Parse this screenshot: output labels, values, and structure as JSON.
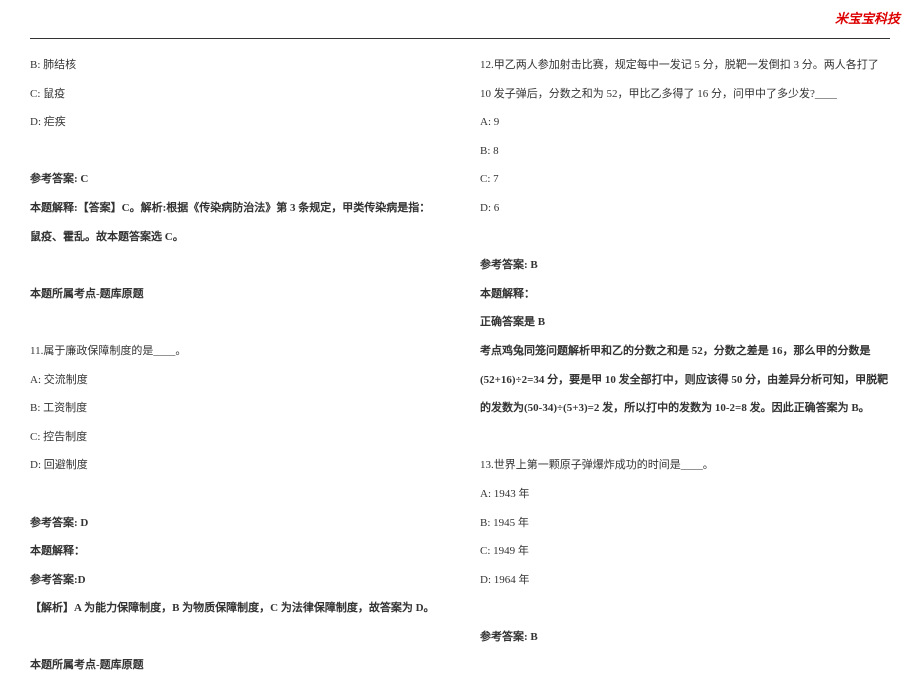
{
  "watermark": "米宝宝科技",
  "left": {
    "q10_opt_b": "B: 肺结核",
    "q10_opt_c": "C: 鼠疫",
    "q10_opt_d": "D: 疟疾",
    "q10_ans_label": "参考答案: C",
    "q10_exp": "本题解释:【答案】C。解析:根据《传染病防治法》第 3 条规定，甲类传染病是指：鼠疫、霍乱。故本题答案选 C。",
    "q10_point": "本题所属考点-题库原题",
    "q11_stem": "11.属于廉政保障制度的是____。",
    "q11_opt_a": "A: 交流制度",
    "q11_opt_b": "B: 工资制度",
    "q11_opt_c": "C: 控告制度",
    "q11_opt_d": "D: 回避制度",
    "q11_ans_label": "参考答案: D",
    "q11_exp_head": "本题解释：",
    "q11_exp_ans": "参考答案:D",
    "q11_exp_body": "【解析】A 为能力保障制度，B 为物质保障制度，C 为法律保障制度，故答案为 D。",
    "q11_point": "本题所属考点-题库原题"
  },
  "right": {
    "q12_stem": "12.甲乙两人参加射击比赛，规定每中一发记 5 分，脱靶一发倒扣 3 分。两人各打了 10 发子弹后，分数之和为 52，甲比乙多得了 16 分，问甲中了多少发?____",
    "q12_opt_a": "A: 9",
    "q12_opt_b": "B: 8",
    "q12_opt_c": "C: 7",
    "q12_opt_d": "D: 6",
    "q12_ans_label": "参考答案: B",
    "q12_exp_head": "本题解释：",
    "q12_exp_correct": "正确答案是 B",
    "q12_exp_body": "考点鸡兔同笼问题解析甲和乙的分数之和是 52，分数之差是 16，那么甲的分数是(52+16)÷2=34 分，要是甲 10 发全部打中，则应该得 50 分，由差异分析可知，甲脱靶的发数为(50-34)÷(5+3)=2 发，所以打中的发数为 10-2=8 发。因此正确答案为 B。",
    "q13_stem": "13.世界上第一颗原子弹爆炸成功的时间是____。",
    "q13_opt_a": "A: 1943 年",
    "q13_opt_b": "B: 1945 年",
    "q13_opt_c": "C: 1949 年",
    "q13_opt_d": "D: 1964 年",
    "q13_ans_label": "参考答案: B"
  }
}
